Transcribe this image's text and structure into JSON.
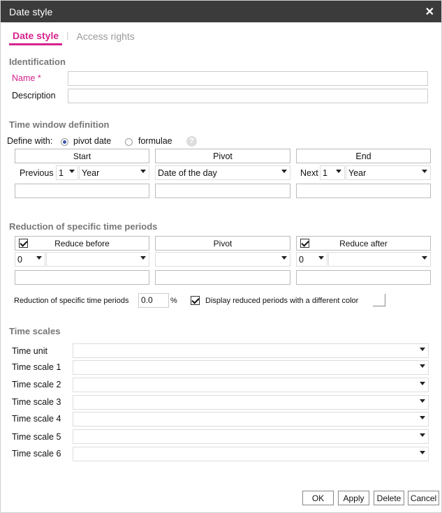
{
  "window": {
    "title": "Date style"
  },
  "tabs": [
    {
      "label": "Date style"
    },
    {
      "label": "Access rights"
    }
  ],
  "identification": {
    "title": "Identification",
    "name_label": "Name *",
    "description_label": "Description",
    "name_value": "",
    "description_value": ""
  },
  "time_window": {
    "title": "Time window definition",
    "define_with_label": "Define with:",
    "option_pivot": "pivot date",
    "option_formulae": "formulae",
    "help": "?",
    "start_label": "Start",
    "pivot_label": "Pivot",
    "end_label": "End",
    "start_prefix": "Previous",
    "start_count": "1",
    "start_unit": "Year",
    "pivot_value": "Date of the day",
    "end_prefix": "Next",
    "end_count": "1",
    "end_unit": "Year"
  },
  "reduction": {
    "title": "Reduction of specific time periods",
    "reduce_before": "Reduce before",
    "pivot": "Pivot",
    "reduce_after": "Reduce after",
    "before_count": "0",
    "after_count": "0",
    "percent_label": "Reduction of specific time periods",
    "percent_value": "0.0",
    "percent_unit": "%",
    "display_label": "Display reduced periods with a different color"
  },
  "time_scales": {
    "title": "Time scales",
    "rows": [
      {
        "label": "Time unit"
      },
      {
        "label": "Time scale 1"
      },
      {
        "label": "Time scale 2"
      },
      {
        "label": "Time scale 3"
      },
      {
        "label": "Time scale 4"
      },
      {
        "label": "Time scale 5"
      },
      {
        "label": "Time scale 6"
      }
    ]
  },
  "buttons": {
    "ok": "OK",
    "apply": "Apply",
    "delete": "Delete",
    "cancel": "Cancel"
  },
  "icons": {
    "close": "close-icon",
    "help": "help-icon",
    "dropdown": "chevron-down-icon"
  }
}
